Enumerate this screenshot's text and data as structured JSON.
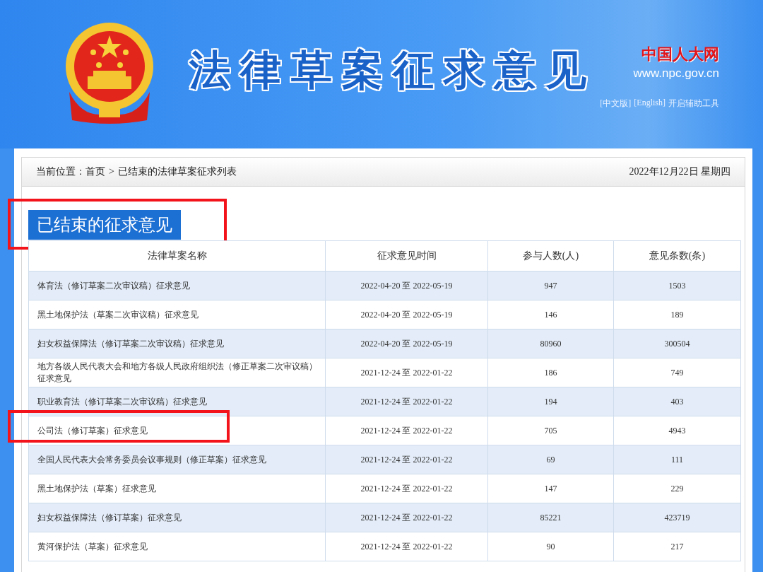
{
  "header": {
    "title": "法律草案征求意见",
    "site_name": "中国人大网",
    "site_url": "www.npc.gov.cn",
    "links": [
      "[中文版]",
      "[English]",
      "开启辅助工具"
    ]
  },
  "breadcrumb": {
    "label": "当前位置：",
    "items": [
      "首页",
      "已结束的法律草案征求列表"
    ],
    "separator": ">",
    "date": "2022年12月22日 星期四"
  },
  "section": {
    "title": "已结束的征求意见",
    "highlighted": true
  },
  "table": {
    "columns": [
      "法律草案名称",
      "征求意见时间",
      "参与人数(人)",
      "意见条数(条)"
    ],
    "rows": [
      {
        "name": "体育法（修订草案二次审议稿）征求意见",
        "period": "2022-04-20 至 2022-05-19",
        "participants": "947",
        "comments": "1503",
        "highlighted": false
      },
      {
        "name": "黑土地保护法（草案二次审议稿）征求意见",
        "period": "2022-04-20 至 2022-05-19",
        "participants": "146",
        "comments": "189",
        "highlighted": false
      },
      {
        "name": "妇女权益保障法（修订草案二次审议稿）征求意见",
        "period": "2022-04-20 至 2022-05-19",
        "participants": "80960",
        "comments": "300504",
        "highlighted": false
      },
      {
        "name": "地方各级人民代表大会和地方各级人民政府组织法（修正草案二次审议稿）征求意见",
        "period": "2021-12-24 至 2022-01-22",
        "participants": "186",
        "comments": "749",
        "highlighted": false
      },
      {
        "name": "职业教育法（修订草案二次审议稿）征求意见",
        "period": "2021-12-24 至 2022-01-22",
        "participants": "194",
        "comments": "403",
        "highlighted": false
      },
      {
        "name": "公司法（修订草案）征求意见",
        "period": "2021-12-24 至 2022-01-22",
        "participants": "705",
        "comments": "4943",
        "highlighted": true
      },
      {
        "name": "全国人民代表大会常务委员会议事规则（修正草案）征求意见",
        "period": "2021-12-24 至 2022-01-22",
        "participants": "69",
        "comments": "111",
        "highlighted": false
      },
      {
        "name": "黑土地保护法（草案）征求意见",
        "period": "2021-12-24 至 2022-01-22",
        "participants": "147",
        "comments": "229",
        "highlighted": false
      },
      {
        "name": "妇女权益保障法（修订草案）征求意见",
        "period": "2021-12-24 至 2022-01-22",
        "participants": "85221",
        "comments": "423719",
        "highlighted": false
      },
      {
        "name": "黄河保护法（草案）征求意见",
        "period": "2021-12-24 至 2022-01-22",
        "participants": "90",
        "comments": "217",
        "highlighted": false
      }
    ]
  }
}
